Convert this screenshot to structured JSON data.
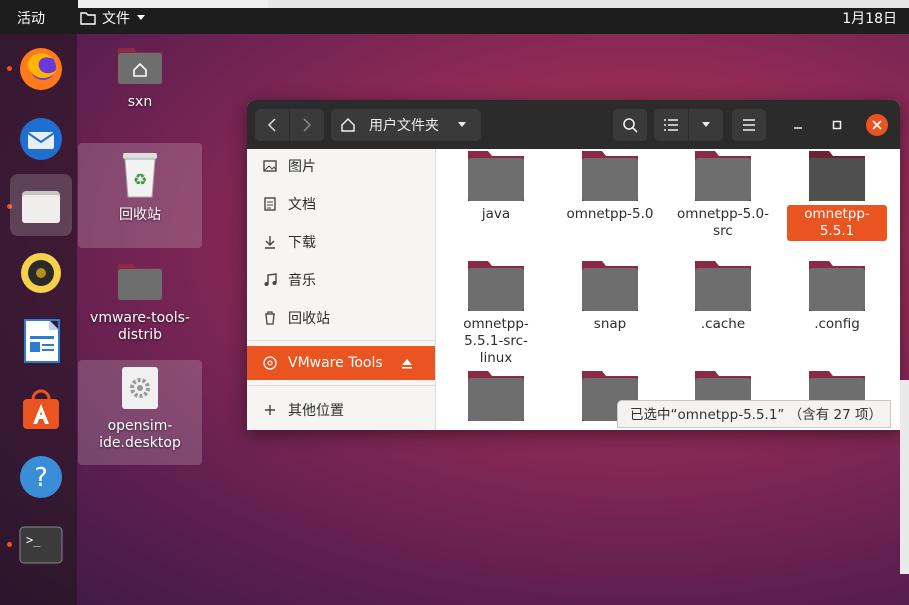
{
  "topbar": {
    "activities": "活动",
    "app_menu": "文件",
    "clock": "1月18日"
  },
  "desktop": {
    "icons": [
      {
        "label": "sxn",
        "icon": "home-folder-icon"
      },
      {
        "label": "回收站",
        "icon": "trash-icon"
      },
      {
        "label": "vmware-tools-distrib",
        "icon": "folder-icon"
      },
      {
        "label": "opensim-ide.desktop",
        "icon": "gear-icon"
      }
    ]
  },
  "dock": {
    "items": [
      "firefox-icon",
      "thunderbird-icon",
      "files-icon",
      "rhythmbox-icon",
      "libreoffice-writer-icon",
      "software-center-icon",
      "help-icon",
      "terminal-icon"
    ]
  },
  "window": {
    "location": "用户文件夹",
    "sidebar": [
      {
        "label": "图片",
        "icon": "pictures-icon"
      },
      {
        "label": "文档",
        "icon": "documents-icon"
      },
      {
        "label": "下载",
        "icon": "download-icon"
      },
      {
        "label": "音乐",
        "icon": "music-icon"
      },
      {
        "label": "回收站",
        "icon": "trash-icon"
      },
      {
        "label": "VMware Tools",
        "icon": "disc-icon"
      },
      {
        "label": "其他位置",
        "icon": "plus-icon"
      }
    ],
    "files": [
      {
        "label": "java"
      },
      {
        "label": "omnetpp-5.0"
      },
      {
        "label": "omnetpp-5.0-src"
      },
      {
        "label": "omnetpp-5.5.1"
      },
      {
        "label": "omnetpp-5.5.1-src-linux"
      },
      {
        "label": "snap"
      },
      {
        "label": ".cache"
      },
      {
        "label": ".config"
      }
    ],
    "status": "已选中“omnetpp-5.5.1” （含有 27 项）"
  },
  "colors": {
    "accent": "#e95420",
    "folder": "#6e6e6e",
    "folder_tab": "#8a2a44",
    "headerbar": "#2b2b2b"
  }
}
